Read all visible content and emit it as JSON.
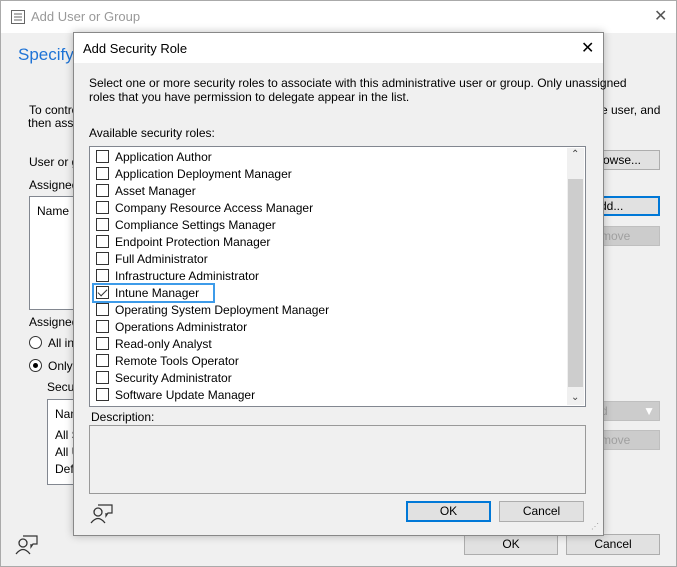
{
  "window": {
    "title": "Add User or Group",
    "heading": "Specify",
    "intro_line1": "To contro",
    "intro_line2": "then assig",
    "intro_right": "e user, and",
    "user_label": "User or gr",
    "browse_label": "owse...",
    "assigned_roles_label": "Assigned",
    "roles_col": "Name",
    "add_label": "dd...",
    "remove_label": "move",
    "assigned_scopes_label": "Assigned",
    "radio_all": "All ins",
    "radio_only": "Only t",
    "scopes_label": "Secur",
    "scope_col": "Nam",
    "scopes": [
      "All S",
      "All U",
      "Defa"
    ],
    "add2_label": "d",
    "remove2_label": "move",
    "ok_label": "OK",
    "cancel_label": "Cancel"
  },
  "dialog": {
    "title": "Add Security Role",
    "description_line1": "Select one or more security roles to associate with this administrative user or group.  Only unassigned",
    "description_line2": "roles that you have permission to delegate appear in the list.",
    "available_label": "Available security roles:",
    "roles": [
      {
        "label": "Application Author",
        "checked": false
      },
      {
        "label": "Application Deployment Manager",
        "checked": false
      },
      {
        "label": "Asset Manager",
        "checked": false
      },
      {
        "label": "Company Resource Access Manager",
        "checked": false
      },
      {
        "label": "Compliance Settings Manager",
        "checked": false
      },
      {
        "label": "Endpoint Protection Manager",
        "checked": false
      },
      {
        "label": "Full Administrator",
        "checked": false
      },
      {
        "label": "Infrastructure Administrator",
        "checked": false
      },
      {
        "label": "Intune Manager",
        "checked": true
      },
      {
        "label": "Operating System Deployment Manager",
        "checked": false
      },
      {
        "label": "Operations Administrator",
        "checked": false
      },
      {
        "label": "Read-only Analyst",
        "checked": false
      },
      {
        "label": "Remote Tools Operator",
        "checked": false
      },
      {
        "label": "Security Administrator",
        "checked": false
      },
      {
        "label": "Software Update Manager",
        "checked": false
      }
    ],
    "description_label": "Description:",
    "ok_label": "OK",
    "cancel_label": "Cancel"
  },
  "colors": {
    "accent": "#0078d7",
    "heading": "#1e73d6",
    "selection": "#3d9be9"
  }
}
